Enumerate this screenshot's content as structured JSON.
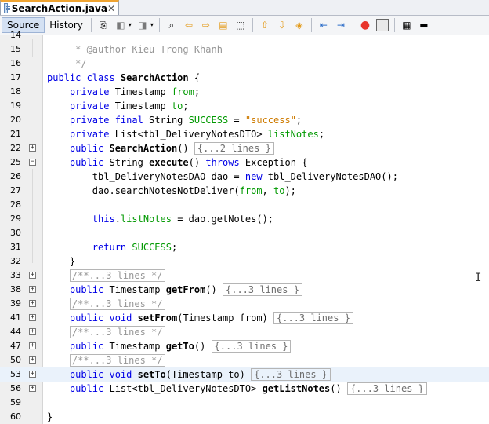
{
  "tab": {
    "title": "SearchAction.java",
    "close": "✕"
  },
  "toolbar": {
    "source_label": "Source",
    "history_label": "History",
    "icons": [
      "last-edit-icon",
      "back-icon",
      "forward-icon",
      "find-icon",
      "find-previous-icon",
      "find-next-icon",
      "find-selection-icon",
      "toggle-highlight-icon",
      "previous-bookmark-icon",
      "next-bookmark-icon",
      "toggle-bookmark-icon",
      "shift-left-icon",
      "shift-right-icon",
      "start-macro-icon",
      "stop-macro-icon",
      "comment-icon",
      "uncomment-icon"
    ]
  },
  "lines": [
    {
      "n": "14",
      "fold": "",
      "code": []
    },
    {
      "n": "15",
      "fold": "",
      "code": [
        {
          "t": "     * @author Kieu Trong Khanh",
          "c": "cmt"
        }
      ]
    },
    {
      "n": "16",
      "fold": "",
      "code": [
        {
          "t": "     */",
          "c": "cmt"
        }
      ]
    },
    {
      "n": "17",
      "fold": "",
      "code": [
        {
          "t": "public class ",
          "c": "kw"
        },
        {
          "t": "SearchAction",
          "c": "bold"
        },
        {
          "t": " {",
          "c": ""
        }
      ]
    },
    {
      "n": "18",
      "fold": "",
      "code": [
        {
          "t": "    private ",
          "c": "kw"
        },
        {
          "t": "Timestamp ",
          "c": ""
        },
        {
          "t": "from",
          "c": "fld"
        },
        {
          "t": ";",
          "c": ""
        }
      ]
    },
    {
      "n": "19",
      "fold": "",
      "code": [
        {
          "t": "    private ",
          "c": "kw"
        },
        {
          "t": "Timestamp ",
          "c": ""
        },
        {
          "t": "to",
          "c": "fld"
        },
        {
          "t": ";",
          "c": ""
        }
      ]
    },
    {
      "n": "20",
      "fold": "",
      "code": [
        {
          "t": "    private final ",
          "c": "kw"
        },
        {
          "t": "String ",
          "c": ""
        },
        {
          "t": "SUCCESS",
          "c": "fld"
        },
        {
          "t": " = ",
          "c": ""
        },
        {
          "t": "\"success\"",
          "c": "str"
        },
        {
          "t": ";",
          "c": ""
        }
      ]
    },
    {
      "n": "21",
      "fold": "",
      "code": [
        {
          "t": "    private ",
          "c": "kw"
        },
        {
          "t": "List<tbl_DeliveryNotesDTO> ",
          "c": ""
        },
        {
          "t": "listNotes",
          "c": "fld"
        },
        {
          "t": ";",
          "c": ""
        }
      ]
    },
    {
      "n": "22",
      "fold": "+",
      "code": [
        {
          "t": "    public ",
          "c": "kw"
        },
        {
          "t": "SearchAction",
          "c": "bold"
        },
        {
          "t": "() ",
          "c": ""
        },
        {
          "t": "{...2 lines }",
          "c": "foldbox"
        }
      ]
    },
    {
      "n": "25",
      "fold": "−",
      "code": [
        {
          "t": "    public ",
          "c": "kw"
        },
        {
          "t": "String ",
          "c": ""
        },
        {
          "t": "execute",
          "c": "bold"
        },
        {
          "t": "() ",
          "c": ""
        },
        {
          "t": "throws ",
          "c": "kw"
        },
        {
          "t": "Exception {",
          "c": ""
        }
      ]
    },
    {
      "n": "26",
      "fold": "",
      "code": [
        {
          "t": "        tbl_DeliveryNotesDAO dao = ",
          "c": ""
        },
        {
          "t": "new ",
          "c": "kw"
        },
        {
          "t": "tbl_DeliveryNotesDAO();",
          "c": ""
        }
      ]
    },
    {
      "n": "27",
      "fold": "",
      "code": [
        {
          "t": "        dao.searchNotesNotDeliver(",
          "c": ""
        },
        {
          "t": "from",
          "c": "fld"
        },
        {
          "t": ", ",
          "c": ""
        },
        {
          "t": "to",
          "c": "fld"
        },
        {
          "t": ");",
          "c": ""
        }
      ]
    },
    {
      "n": "28",
      "fold": "",
      "code": []
    },
    {
      "n": "29",
      "fold": "",
      "code": [
        {
          "t": "        ",
          "c": ""
        },
        {
          "t": "this",
          "c": "kw"
        },
        {
          "t": ".",
          "c": ""
        },
        {
          "t": "listNotes",
          "c": "fld"
        },
        {
          "t": " = dao.getNotes();",
          "c": ""
        }
      ]
    },
    {
      "n": "30",
      "fold": "",
      "code": []
    },
    {
      "n": "31",
      "fold": "",
      "code": [
        {
          "t": "        ",
          "c": ""
        },
        {
          "t": "return ",
          "c": "kw"
        },
        {
          "t": "SUCCESS",
          "c": "fld"
        },
        {
          "t": ";",
          "c": ""
        }
      ]
    },
    {
      "n": "32",
      "fold": "",
      "code": [
        {
          "t": "    }",
          "c": ""
        }
      ]
    },
    {
      "n": "33",
      "fold": "+",
      "code": [
        {
          "t": "    ",
          "c": ""
        },
        {
          "t": "/**...3 lines */",
          "c": "cmtbox"
        }
      ]
    },
    {
      "n": "38",
      "fold": "+",
      "code": [
        {
          "t": "    public ",
          "c": "kw"
        },
        {
          "t": "Timestamp ",
          "c": ""
        },
        {
          "t": "getFrom",
          "c": "bold"
        },
        {
          "t": "() ",
          "c": ""
        },
        {
          "t": "{...3 lines }",
          "c": "foldbox"
        }
      ]
    },
    {
      "n": "39",
      "fold": "+",
      "code": [
        {
          "t": "    ",
          "c": ""
        },
        {
          "t": "/**...3 lines */",
          "c": "cmtbox"
        }
      ]
    },
    {
      "n": "41",
      "fold": "+",
      "code": [
        {
          "t": "    public void ",
          "c": "kw"
        },
        {
          "t": "setFrom",
          "c": "bold"
        },
        {
          "t": "(Timestamp from) ",
          "c": ""
        },
        {
          "t": "{...3 lines }",
          "c": "foldbox"
        }
      ]
    },
    {
      "n": "44",
      "fold": "+",
      "code": [
        {
          "t": "    ",
          "c": ""
        },
        {
          "t": "/**...3 lines */",
          "c": "cmtbox"
        }
      ]
    },
    {
      "n": "47",
      "fold": "+",
      "code": [
        {
          "t": "    public ",
          "c": "kw"
        },
        {
          "t": "Timestamp ",
          "c": ""
        },
        {
          "t": "getTo",
          "c": "bold"
        },
        {
          "t": "() ",
          "c": ""
        },
        {
          "t": "{...3 lines }",
          "c": "foldbox"
        }
      ]
    },
    {
      "n": "50",
      "fold": "+",
      "code": [
        {
          "t": "    ",
          "c": ""
        },
        {
          "t": "/**...3 lines */",
          "c": "cmtbox"
        }
      ]
    },
    {
      "n": "53",
      "fold": "+",
      "code": [
        {
          "t": "    public void ",
          "c": "kw"
        },
        {
          "t": "setTo",
          "c": "bold"
        },
        {
          "t": "(Timestamp to) ",
          "c": ""
        },
        {
          "t": "{...3 lines }",
          "c": "foldbox"
        }
      ],
      "highlight": true
    },
    {
      "n": "56",
      "fold": "+",
      "code": [
        {
          "t": "    public ",
          "c": "kw"
        },
        {
          "t": "List<tbl_DeliveryNotesDTO> ",
          "c": ""
        },
        {
          "t": "getListNotes",
          "c": "bold"
        },
        {
          "t": "() ",
          "c": ""
        },
        {
          "t": "{...3 lines }",
          "c": "foldbox"
        }
      ]
    },
    {
      "n": "59",
      "fold": "",
      "code": []
    },
    {
      "n": "60",
      "fold": "",
      "code": [
        {
          "t": "}",
          "c": ""
        }
      ]
    }
  ]
}
